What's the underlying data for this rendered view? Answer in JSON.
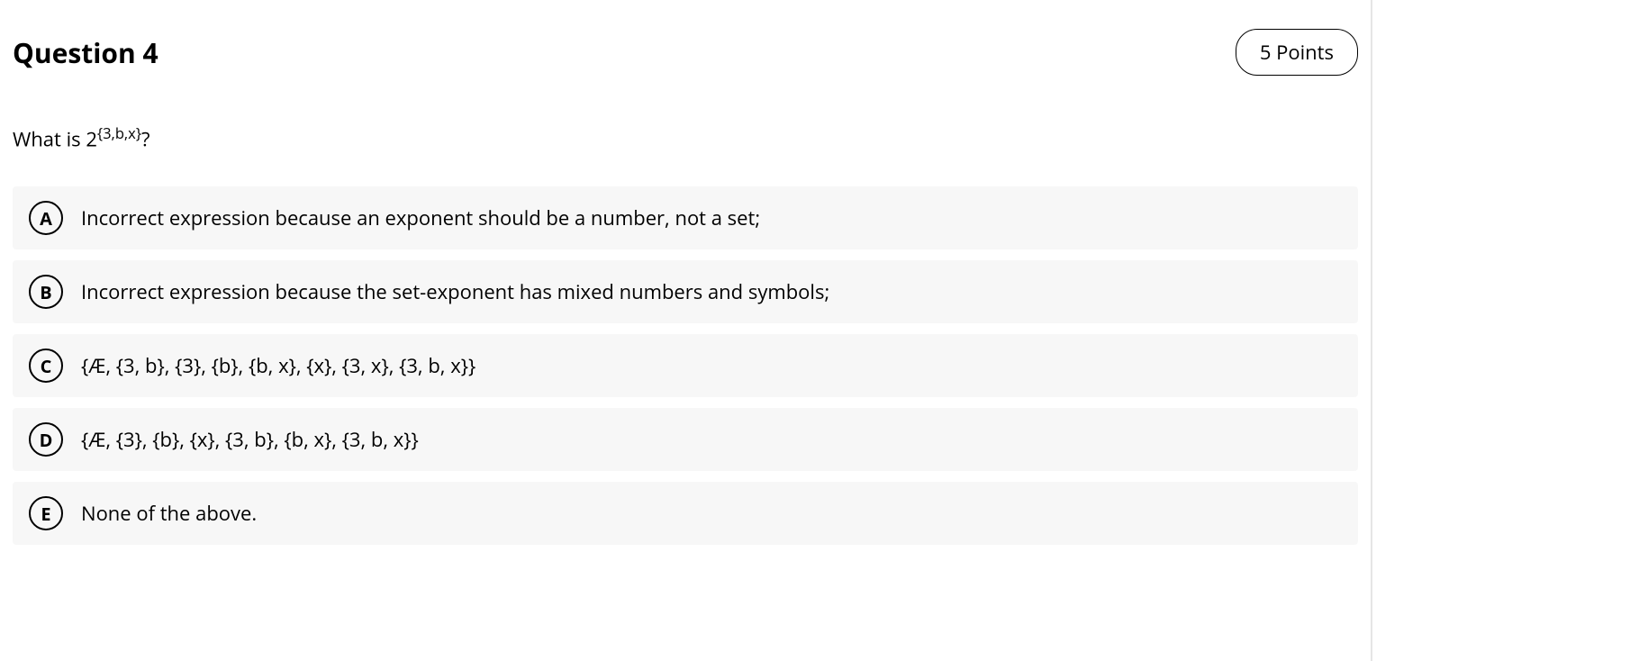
{
  "header": {
    "title": "Question 4",
    "points": "5 Points"
  },
  "prompt": {
    "prefix": "What is 2",
    "exponent": "{3,b,x}",
    "suffix": "?"
  },
  "options": [
    {
      "letter": "A",
      "text": "Incorrect expression because an exponent should be a number, not a set;"
    },
    {
      "letter": "B",
      "text": "Incorrect expression because the set-exponent has mixed numbers and symbols;"
    },
    {
      "letter": "C",
      "text": "{Æ, {3, b}, {3}, {b}, {b, x}, {x}, {3, x}, {3, b, x}}"
    },
    {
      "letter": "D",
      "text": "{Æ, {3}, {b}, {x}, {3, b}, {b, x}, {3, b, x}}"
    },
    {
      "letter": "E",
      "text": "None of the above."
    }
  ]
}
